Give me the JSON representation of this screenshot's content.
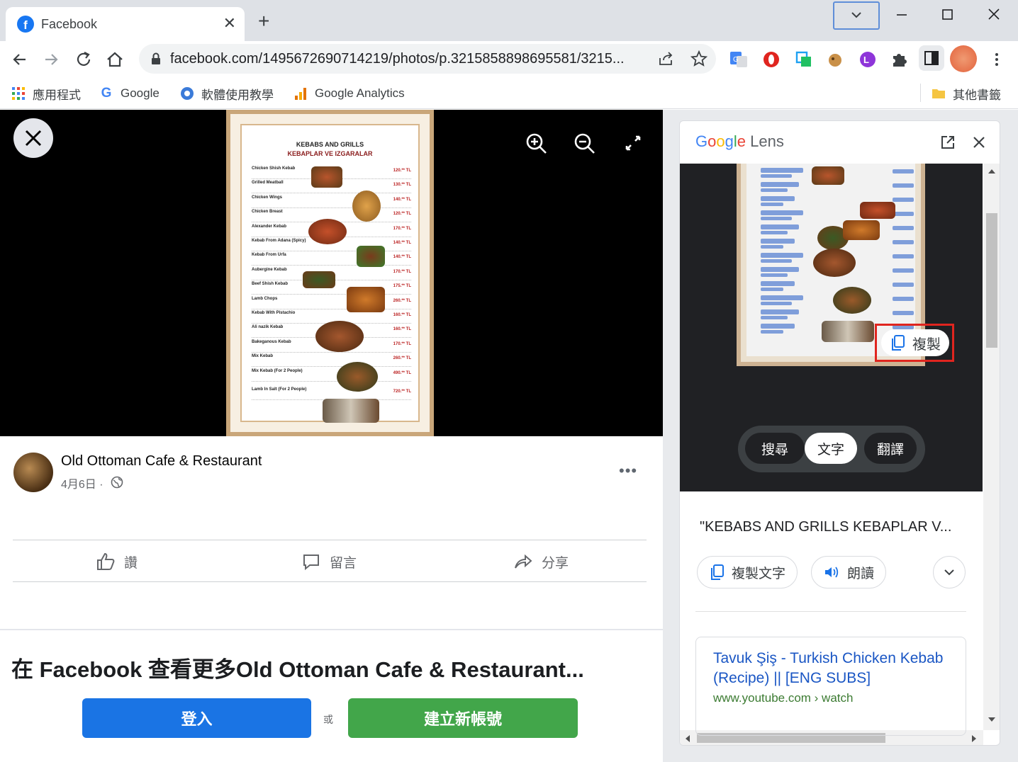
{
  "browser": {
    "tab_title": "Facebook",
    "url": "facebook.com/1495672690714219/photos/p.3215858898695581/3215...",
    "bookmarks": [
      {
        "label": "應用程式"
      },
      {
        "label": "Google"
      },
      {
        "label": "軟體使用教學"
      },
      {
        "label": "Google Analytics"
      },
      {
        "label": "其他書籤"
      }
    ]
  },
  "menu_image": {
    "heading": "KEBABS AND GRILLS",
    "subheading": "KEBAPLAR VE IZGARALAR",
    "items": [
      {
        "name": "Chicken Shish Kebab",
        "price": "120.** TL"
      },
      {
        "name": "Grilled Meatball",
        "price": "130.** TL"
      },
      {
        "name": "Chicken Wings",
        "price": "140.** TL"
      },
      {
        "name": "Chicken Breast",
        "price": "120.** TL"
      },
      {
        "name": "Alexander Kebab",
        "price": "170.** TL"
      },
      {
        "name": "Kebab From Adana (Spicy)",
        "price": "140.** TL"
      },
      {
        "name": "Kebab From Urfa",
        "price": "140.** TL"
      },
      {
        "name": "Aubergine Kebab",
        "price": "170.** TL"
      },
      {
        "name": "Beef Shish Kebab",
        "price": "175.** TL"
      },
      {
        "name": "Lamb Chops",
        "price": "260.** TL"
      },
      {
        "name": "Kebab With Pistachio",
        "price": "160.** TL"
      },
      {
        "name": "Ali nazik Kebab",
        "price": "160.** TL"
      },
      {
        "name": "Bakeganous Kebab",
        "price": "170.** TL"
      },
      {
        "name": "Mix Kebab",
        "price": "260.** TL"
      },
      {
        "name": "Mix Kebab (For 2 People)",
        "price": "490.** TL"
      },
      {
        "name": "Lamb In Salt (For 2 People)",
        "price": "720.** TL"
      }
    ]
  },
  "post": {
    "page_name": "Old Ottoman Cafe & Restaurant",
    "date": "4月6日 ·",
    "more": "•••",
    "actions": {
      "like": "讚",
      "comment": "留言",
      "share": "分享"
    }
  },
  "login": {
    "title": "在 Facebook 查看更多Old Ottoman Cafe & Restaurant...",
    "login_label": "登入",
    "or_label": "或",
    "signup_label": "建立新帳號"
  },
  "lens": {
    "logo_letters": [
      "G",
      "o",
      "o",
      "g",
      "l",
      "e"
    ],
    "logo_suffix": " Lens",
    "copy_label": "複製",
    "modes": [
      {
        "label": "搜尋",
        "selected": false
      },
      {
        "label": "文字",
        "selected": true
      },
      {
        "label": "翻譯",
        "selected": false
      }
    ],
    "result_text": "\"KEBABS AND GRILLS KEBAPLAR V...",
    "copy_text_label": "複製文字",
    "read_aloud_label": "朗讀",
    "result_card": {
      "title": "Tavuk Şiş - Turkish Chicken Kebab (Recipe) || [ENG SUBS]",
      "url": "www.youtube.com › watch"
    }
  },
  "colors": {
    "facebook_blue": "#1877f2",
    "login_button": "#1a74e4",
    "signup_button": "#42a64a",
    "highlight_red": "#e0251f",
    "link_blue": "#1a56c4"
  }
}
